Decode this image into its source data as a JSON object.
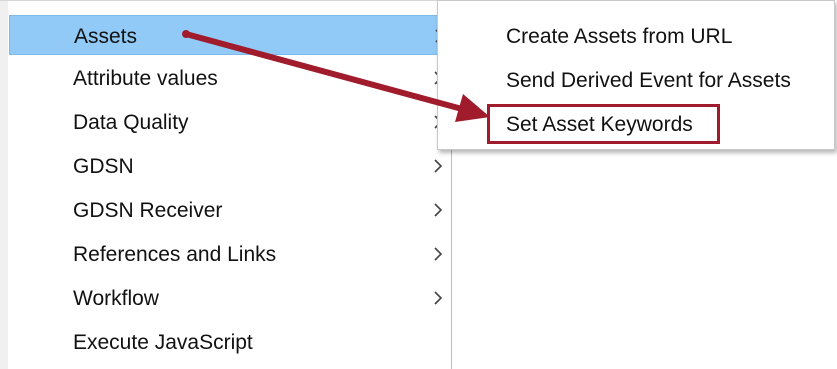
{
  "main_menu": {
    "items": [
      {
        "label": "Assets",
        "has_submenu": true,
        "highlighted": true
      },
      {
        "label": "Attribute values",
        "has_submenu": true
      },
      {
        "label": "Data Quality",
        "has_submenu": true
      },
      {
        "label": "GDSN",
        "has_submenu": true
      },
      {
        "label": "GDSN Receiver",
        "has_submenu": true
      },
      {
        "label": "References and Links",
        "has_submenu": true
      },
      {
        "label": "Workflow",
        "has_submenu": true
      },
      {
        "label": "Execute JavaScript",
        "has_submenu": false
      }
    ]
  },
  "sub_menu": {
    "items": [
      {
        "label": "Create Assets from URL"
      },
      {
        "label": "Send Derived Event for Assets"
      },
      {
        "label": "Set Asset Keywords",
        "callout": true
      }
    ]
  },
  "annotation": {
    "arrow_color": "#a01c2c",
    "box_color": "#a01c2c"
  },
  "icons": {
    "submenu_indicator": "chevron-right-icon"
  },
  "colors": {
    "highlight": "#91c9f7",
    "text": "#111111"
  }
}
